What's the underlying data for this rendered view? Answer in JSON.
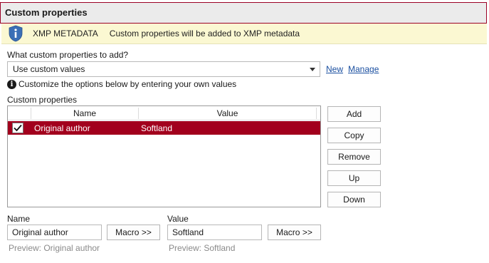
{
  "header": {
    "title": "Custom properties"
  },
  "banner": {
    "title": "XMP METADATA",
    "message": "Custom properties will be added to XMP metadata",
    "icon": "shield-info-icon"
  },
  "properties": {
    "question_label": "What custom properties to add?",
    "selected_option": "Use custom values",
    "new_link": "New",
    "manage_link": "Manage",
    "info_text": "Customize the options below by entering your own values",
    "list_label": "Custom properties"
  },
  "grid": {
    "columns": [
      "Name",
      "Value"
    ],
    "rows": [
      {
        "checked": true,
        "name": "Original author",
        "value": "Softland"
      }
    ]
  },
  "buttons": {
    "add": "Add",
    "copy": "Copy",
    "remove": "Remove",
    "up": "Up",
    "down": "Down",
    "macro_name": "Macro >>",
    "macro_value": "Macro >>"
  },
  "editor": {
    "name_label": "Name",
    "name_value": "Original author",
    "name_preview": "Preview:  Original author",
    "value_label": "Value",
    "value_value": "Softland",
    "value_preview": "Preview:  Softland"
  },
  "colors": {
    "accent": "#a2001d",
    "banner_bg": "#fbf8d2",
    "link": "#1a4fa0",
    "shield": "#3b6fb6"
  }
}
